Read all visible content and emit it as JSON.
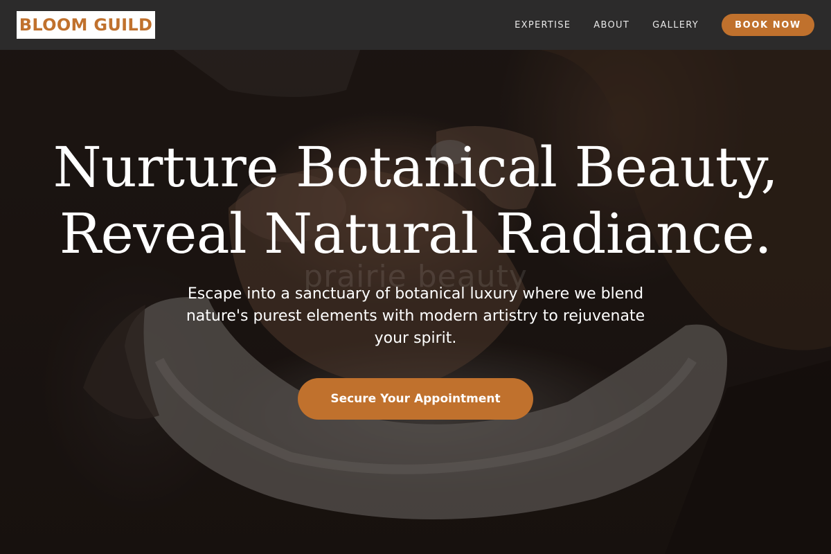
{
  "header": {
    "logo_text": "BLOOM GUILD",
    "nav": [
      {
        "label": "EXPERTISE"
      },
      {
        "label": "ABOUT"
      },
      {
        "label": "GALLERY"
      }
    ],
    "book_label": "BOOK NOW"
  },
  "hero": {
    "title_line1": "Nurture Botanical Beauty,",
    "title_line2": "Reveal Natural Radiance.",
    "subtitle": "Escape into a sanctuary of botanical luxury where we blend nature's purest elements with modern artistry to rejuvenate your spirit.",
    "cta_label": "Secure Your Appointment",
    "watermark": "prairie beauty"
  },
  "colors": {
    "accent": "#c0712d",
    "header_bg": "#2c2b2b",
    "text": "#ffffff"
  }
}
